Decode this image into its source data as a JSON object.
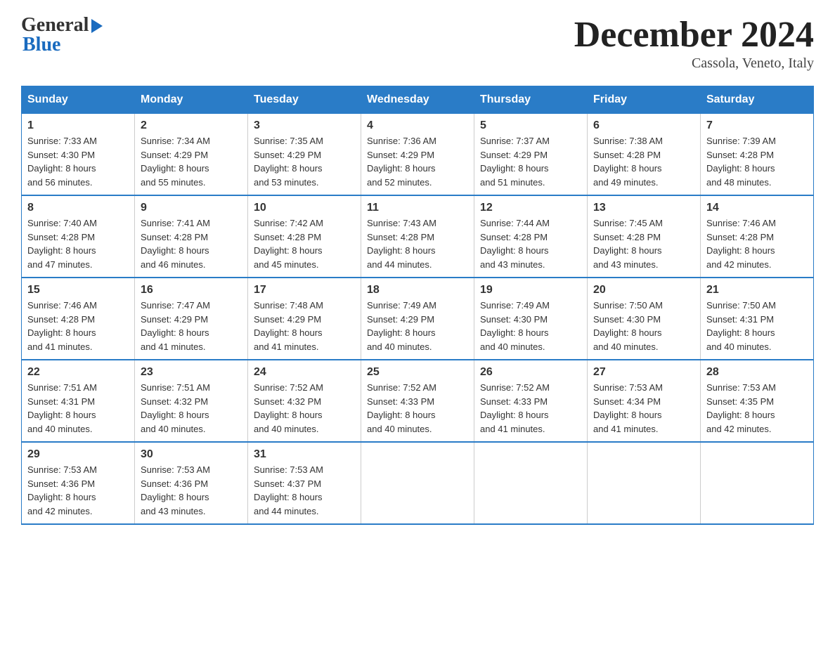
{
  "header": {
    "logo_general": "General",
    "logo_blue": "Blue",
    "month_title": "December 2024",
    "location": "Cassola, Veneto, Italy"
  },
  "days_of_week": [
    "Sunday",
    "Monday",
    "Tuesday",
    "Wednesday",
    "Thursday",
    "Friday",
    "Saturday"
  ],
  "weeks": [
    [
      {
        "day": "1",
        "sunrise": "7:33 AM",
        "sunset": "4:30 PM",
        "daylight": "8 hours and 56 minutes."
      },
      {
        "day": "2",
        "sunrise": "7:34 AM",
        "sunset": "4:29 PM",
        "daylight": "8 hours and 55 minutes."
      },
      {
        "day": "3",
        "sunrise": "7:35 AM",
        "sunset": "4:29 PM",
        "daylight": "8 hours and 53 minutes."
      },
      {
        "day": "4",
        "sunrise": "7:36 AM",
        "sunset": "4:29 PM",
        "daylight": "8 hours and 52 minutes."
      },
      {
        "day": "5",
        "sunrise": "7:37 AM",
        "sunset": "4:29 PM",
        "daylight": "8 hours and 51 minutes."
      },
      {
        "day": "6",
        "sunrise": "7:38 AM",
        "sunset": "4:28 PM",
        "daylight": "8 hours and 49 minutes."
      },
      {
        "day": "7",
        "sunrise": "7:39 AM",
        "sunset": "4:28 PM",
        "daylight": "8 hours and 48 minutes."
      }
    ],
    [
      {
        "day": "8",
        "sunrise": "7:40 AM",
        "sunset": "4:28 PM",
        "daylight": "8 hours and 47 minutes."
      },
      {
        "day": "9",
        "sunrise": "7:41 AM",
        "sunset": "4:28 PM",
        "daylight": "8 hours and 46 minutes."
      },
      {
        "day": "10",
        "sunrise": "7:42 AM",
        "sunset": "4:28 PM",
        "daylight": "8 hours and 45 minutes."
      },
      {
        "day": "11",
        "sunrise": "7:43 AM",
        "sunset": "4:28 PM",
        "daylight": "8 hours and 44 minutes."
      },
      {
        "day": "12",
        "sunrise": "7:44 AM",
        "sunset": "4:28 PM",
        "daylight": "8 hours and 43 minutes."
      },
      {
        "day": "13",
        "sunrise": "7:45 AM",
        "sunset": "4:28 PM",
        "daylight": "8 hours and 43 minutes."
      },
      {
        "day": "14",
        "sunrise": "7:46 AM",
        "sunset": "4:28 PM",
        "daylight": "8 hours and 42 minutes."
      }
    ],
    [
      {
        "day": "15",
        "sunrise": "7:46 AM",
        "sunset": "4:28 PM",
        "daylight": "8 hours and 41 minutes."
      },
      {
        "day": "16",
        "sunrise": "7:47 AM",
        "sunset": "4:29 PM",
        "daylight": "8 hours and 41 minutes."
      },
      {
        "day": "17",
        "sunrise": "7:48 AM",
        "sunset": "4:29 PM",
        "daylight": "8 hours and 41 minutes."
      },
      {
        "day": "18",
        "sunrise": "7:49 AM",
        "sunset": "4:29 PM",
        "daylight": "8 hours and 40 minutes."
      },
      {
        "day": "19",
        "sunrise": "7:49 AM",
        "sunset": "4:30 PM",
        "daylight": "8 hours and 40 minutes."
      },
      {
        "day": "20",
        "sunrise": "7:50 AM",
        "sunset": "4:30 PM",
        "daylight": "8 hours and 40 minutes."
      },
      {
        "day": "21",
        "sunrise": "7:50 AM",
        "sunset": "4:31 PM",
        "daylight": "8 hours and 40 minutes."
      }
    ],
    [
      {
        "day": "22",
        "sunrise": "7:51 AM",
        "sunset": "4:31 PM",
        "daylight": "8 hours and 40 minutes."
      },
      {
        "day": "23",
        "sunrise": "7:51 AM",
        "sunset": "4:32 PM",
        "daylight": "8 hours and 40 minutes."
      },
      {
        "day": "24",
        "sunrise": "7:52 AM",
        "sunset": "4:32 PM",
        "daylight": "8 hours and 40 minutes."
      },
      {
        "day": "25",
        "sunrise": "7:52 AM",
        "sunset": "4:33 PM",
        "daylight": "8 hours and 40 minutes."
      },
      {
        "day": "26",
        "sunrise": "7:52 AM",
        "sunset": "4:33 PM",
        "daylight": "8 hours and 41 minutes."
      },
      {
        "day": "27",
        "sunrise": "7:53 AM",
        "sunset": "4:34 PM",
        "daylight": "8 hours and 41 minutes."
      },
      {
        "day": "28",
        "sunrise": "7:53 AM",
        "sunset": "4:35 PM",
        "daylight": "8 hours and 42 minutes."
      }
    ],
    [
      {
        "day": "29",
        "sunrise": "7:53 AM",
        "sunset": "4:36 PM",
        "daylight": "8 hours and 42 minutes."
      },
      {
        "day": "30",
        "sunrise": "7:53 AM",
        "sunset": "4:36 PM",
        "daylight": "8 hours and 43 minutes."
      },
      {
        "day": "31",
        "sunrise": "7:53 AM",
        "sunset": "4:37 PM",
        "daylight": "8 hours and 44 minutes."
      },
      null,
      null,
      null,
      null
    ]
  ]
}
